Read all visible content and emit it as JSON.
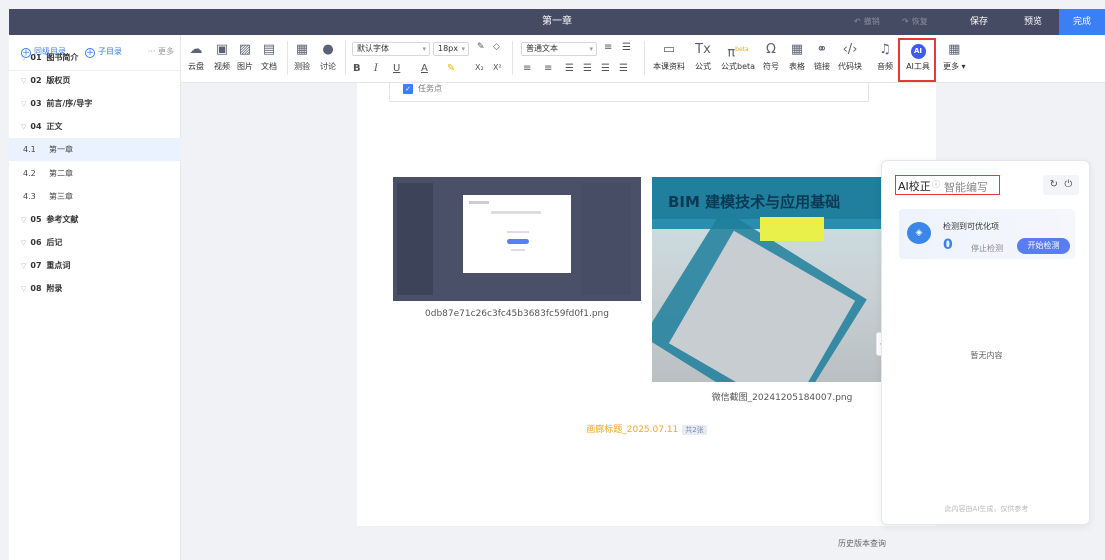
{
  "topbar": {
    "title": "第一章",
    "undo": "撤销",
    "redo": "恢复",
    "save": "保存",
    "preview": "预览",
    "done": "完成"
  },
  "sidebar": {
    "add_sibling": "同级目录",
    "add_child": "子目录",
    "more": "更多",
    "items": [
      {
        "num": "01",
        "label": "图书简介",
        "level": 1
      },
      {
        "num": "02",
        "label": "版权页",
        "level": 1
      },
      {
        "num": "03",
        "label": "前言/序/导字",
        "level": 1
      },
      {
        "num": "04",
        "label": "正文",
        "level": 1
      },
      {
        "num": "4.1",
        "label": "第一章",
        "level": 2,
        "active": true
      },
      {
        "num": "4.2",
        "label": "第二章",
        "level": 2
      },
      {
        "num": "4.3",
        "label": "第三章",
        "level": 2
      },
      {
        "num": "05",
        "label": "参考文献",
        "level": 1
      },
      {
        "num": "06",
        "label": "后记",
        "level": 1
      },
      {
        "num": "07",
        "label": "重点词",
        "level": 1
      },
      {
        "num": "08",
        "label": "附录",
        "level": 1
      }
    ]
  },
  "toolbar": {
    "media": [
      "云盘",
      "视频",
      "图片",
      "文档"
    ],
    "interact": [
      "测验",
      "讨论"
    ],
    "font_family": "默认字体",
    "font_size": "18px",
    "paragraph_style": "普通文本",
    "insert": [
      "本课资料",
      "公式",
      "公式beta",
      "符号",
      "表格",
      "链接",
      "代码块",
      "音频"
    ],
    "ai_tool": "AI工具",
    "ai_badge": "AI",
    "more": "更多",
    "beta_tag": "beta",
    "format_buttons": [
      "B",
      "I",
      "U",
      "A",
      "X₂",
      "X²"
    ]
  },
  "doc": {
    "task_label": "任务点",
    "image1_caption": "0db87e71c26c3fc45b3683fc59fd0f1.png",
    "image2_caption": "微信截图_20241205184007.png",
    "image2_title": "BIM 建模技术与应用基础",
    "gallery_title": "画廊标题_2025.07.11",
    "gallery_count": "共2张"
  },
  "history": "历史版本查询",
  "ai_panel": {
    "tab_active": "AI校正",
    "tab_other": "智能编写",
    "detect_title": "检测到可优化项",
    "count": "0",
    "stop": "停止检测",
    "start": "开始检测",
    "empty": "暂无内容",
    "footer": "此内容由AI生成，仅供参考"
  }
}
